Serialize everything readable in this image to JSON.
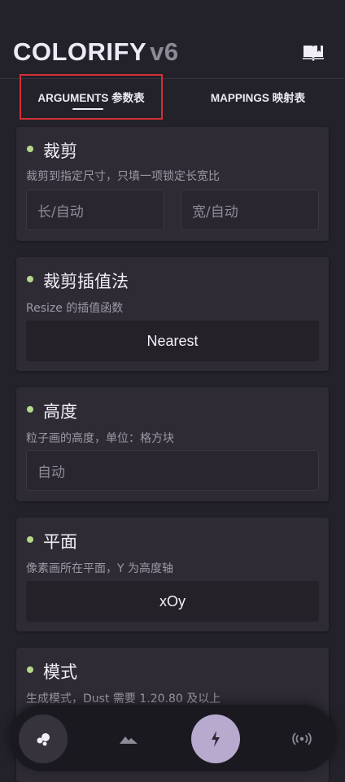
{
  "app": {
    "name": "COLORIFY",
    "version": "v6"
  },
  "tabs": [
    {
      "label": "ARGUMENTS 参数表",
      "active": true
    },
    {
      "label": "MAPPINGS 映射表",
      "active": false
    }
  ],
  "cards": {
    "crop": {
      "title": "裁剪",
      "desc": "裁剪到指定尺寸，只填一项锁定长宽比",
      "length_placeholder": "长/自动",
      "width_placeholder": "宽/自动"
    },
    "interp": {
      "title": "裁剪插值法",
      "desc": "Resize 的插值函数",
      "value": "Nearest"
    },
    "height": {
      "title": "高度",
      "desc": "粒子画的高度，单位：格方块",
      "placeholder": "自动"
    },
    "plane": {
      "title": "平面",
      "desc": "像素画所在平面，Y 为高度轴",
      "value": "xOy"
    },
    "mode": {
      "title": "模式",
      "desc": "生成模式，Dust 需要 1.20.80 及以上"
    }
  },
  "nav": {
    "items": [
      "particles-icon",
      "landscape-icon",
      "bolt-icon",
      "broadcast-icon"
    ],
    "active_index": 2
  },
  "colors": {
    "background": "#232129",
    "card": "#2e2b34",
    "accent_dot": "#b5d98a",
    "nav_active": "#b8a9cf",
    "highlight_border": "#d62f36"
  }
}
